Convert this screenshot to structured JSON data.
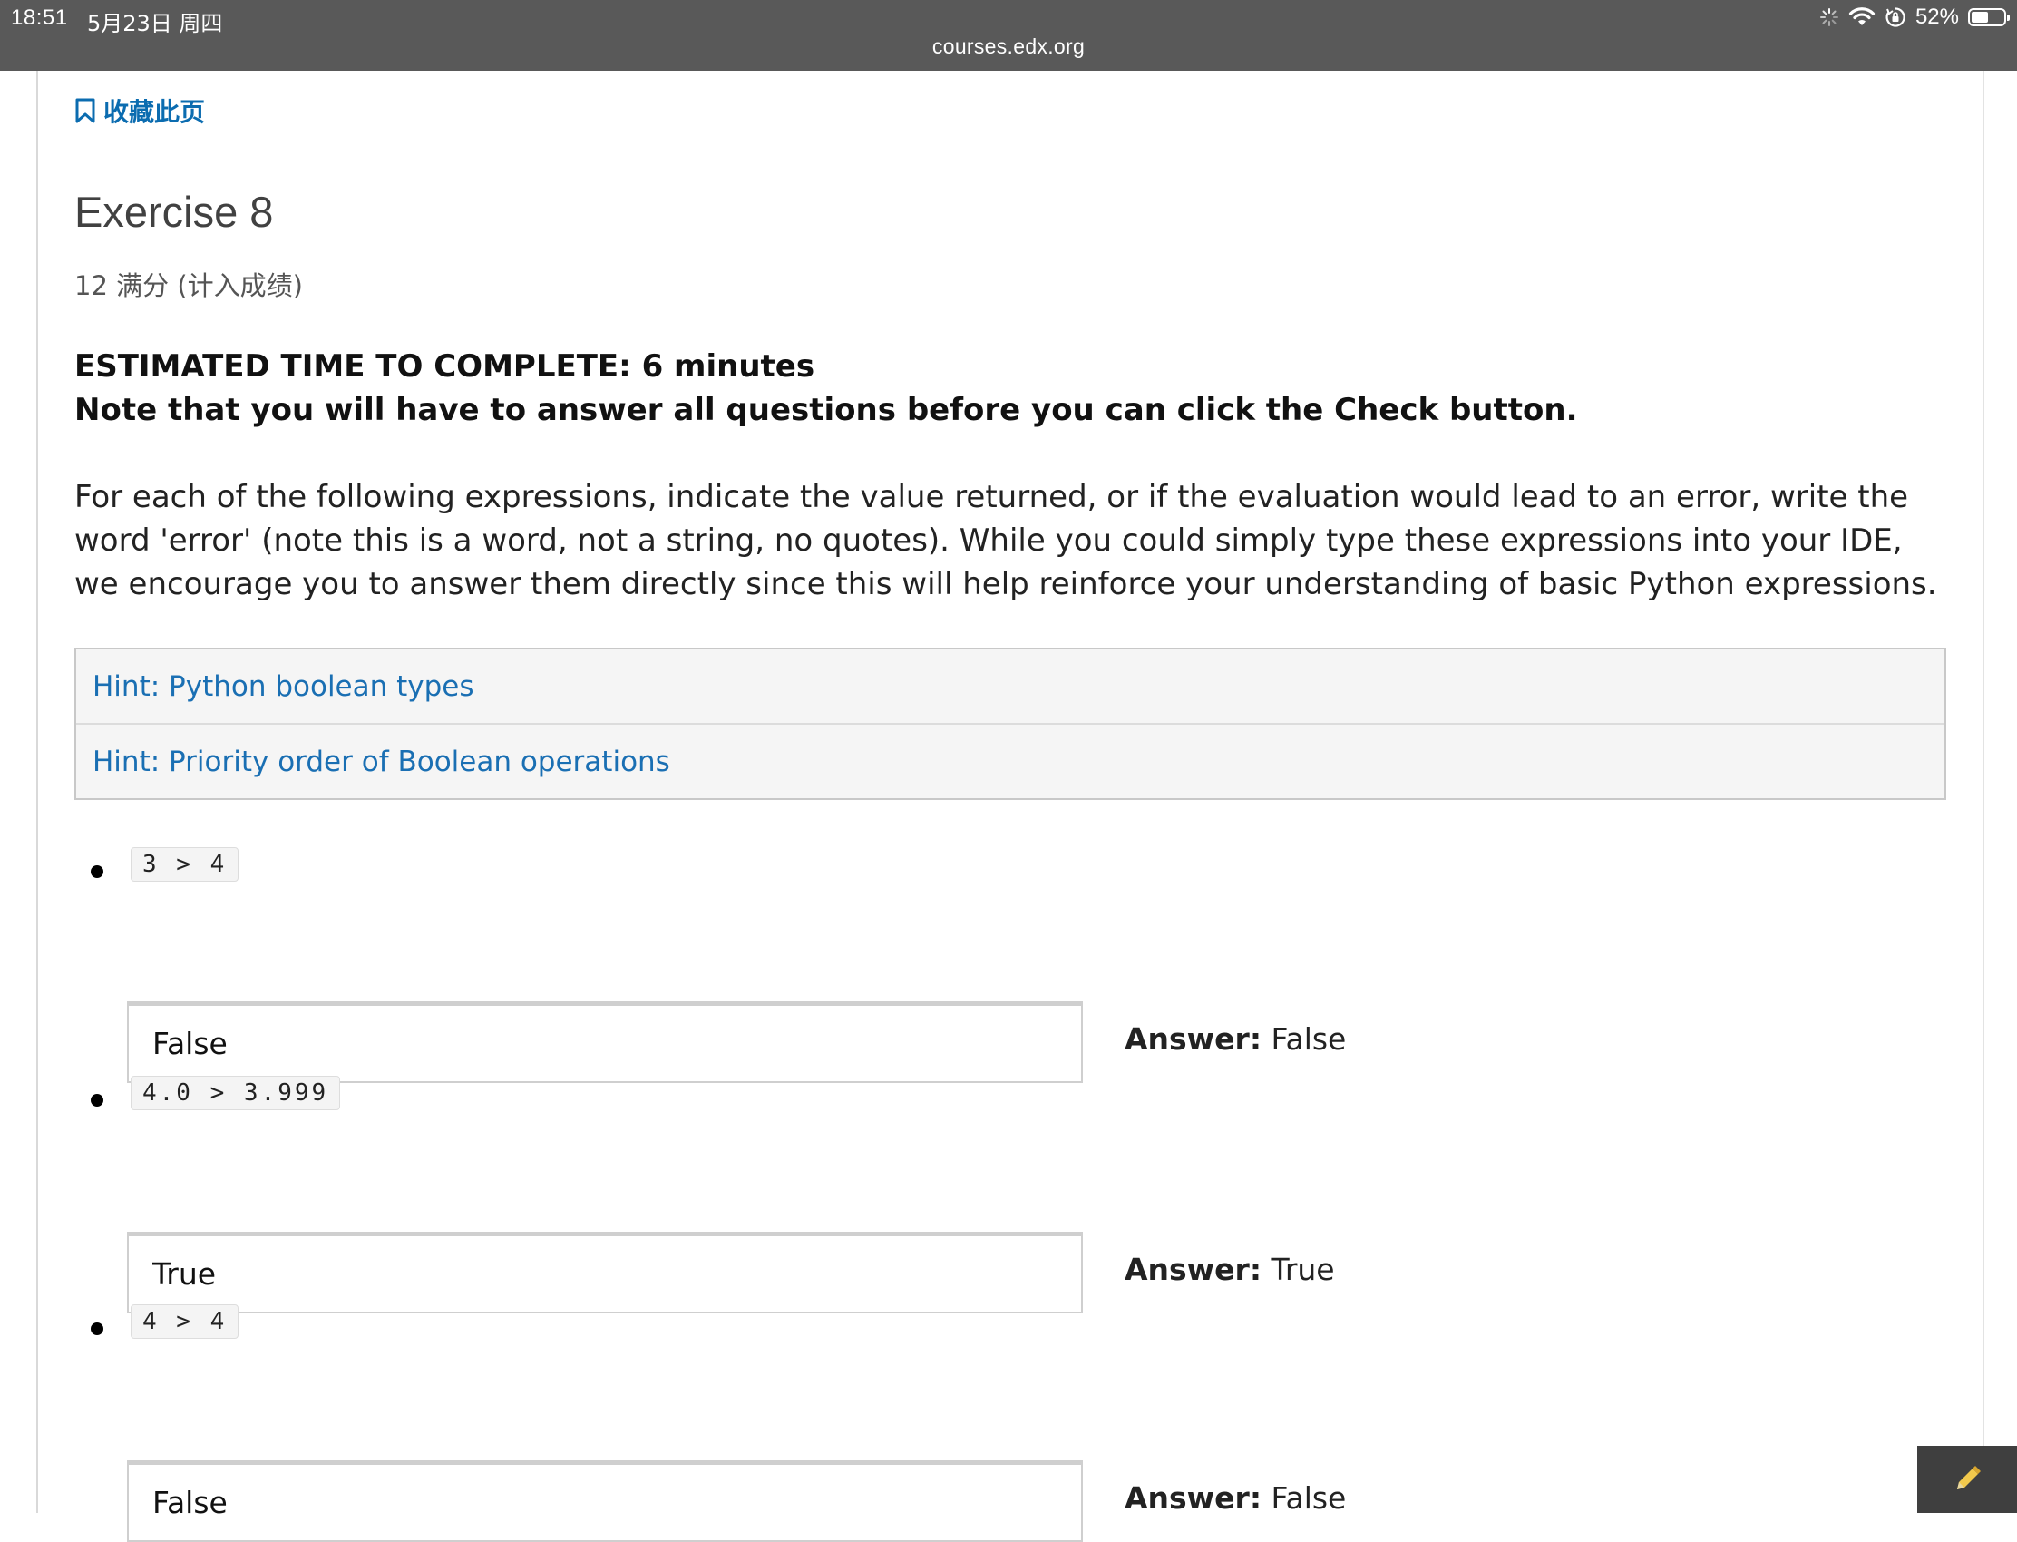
{
  "status_bar": {
    "time": "18:51",
    "date": "5月23日 周四",
    "battery": "52%",
    "battery_level": 0.52,
    "icons": [
      "loading-icon",
      "wifi-icon",
      "orientation-lock-icon",
      "battery-icon"
    ]
  },
  "browser": {
    "url": "courses.edx.org"
  },
  "page": {
    "bookmark_label": "收藏此页",
    "title": "Exercise 8",
    "score": "12 满分 (计入成绩)",
    "estimated_time": "ESTIMATED TIME TO COMPLETE: 6 minutes",
    "note": "Note that you will have to answer all questions before you can click the Check button.",
    "description": "For each of the following expressions, indicate the value returned, or if the evaluation would lead to an error, write the word 'error' (note this is a word, not a string, no quotes). While you could simply type these expressions into your IDE, we encourage you to answer them directly since this will help reinforce your understanding of basic Python expressions."
  },
  "hints": [
    {
      "label": "Hint: Python boolean types"
    },
    {
      "label": "Hint: Priority order of Boolean operations"
    }
  ],
  "questions": [
    {
      "expression": "3 > 4",
      "input_value": "False",
      "answer_prefix": "Answer:",
      "answer": "False"
    },
    {
      "expression": "4.0 > 3.999",
      "input_value": "True",
      "answer_prefix": "Answer:",
      "answer": "True"
    },
    {
      "expression": "4 > 4",
      "input_value": "False",
      "answer_prefix": "Answer:",
      "answer": "False"
    }
  ],
  "colors": {
    "topbar": "#595959",
    "link": "#0b6cb0",
    "hint_link": "#1a6fb3",
    "edit_button": "#3f3f3f",
    "pencil": "#f2c94c"
  }
}
